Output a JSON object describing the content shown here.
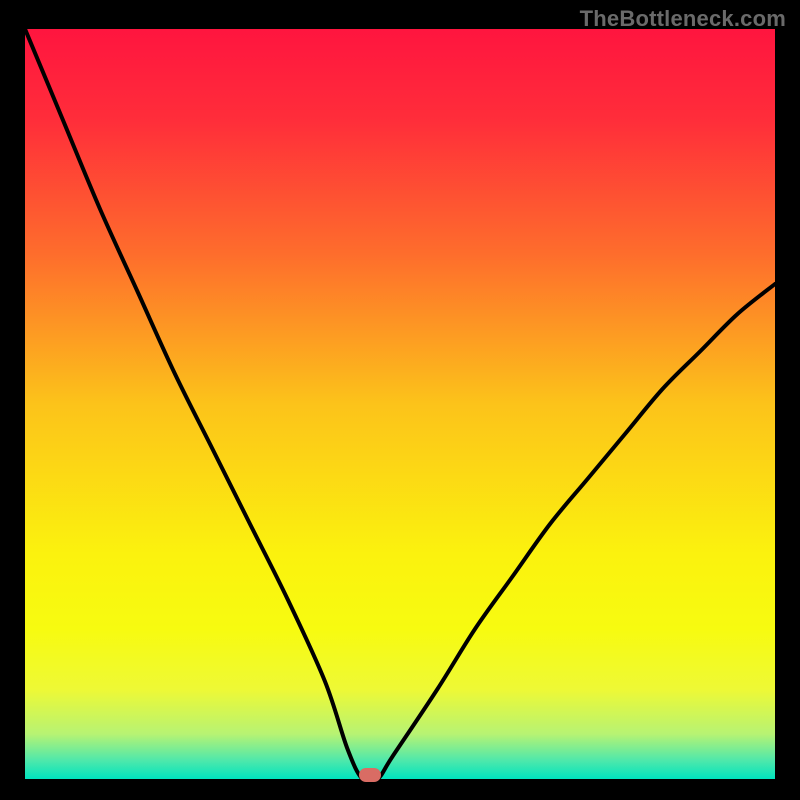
{
  "watermark": "TheBottleneck.com",
  "chart_data": {
    "type": "line",
    "title": "",
    "xlabel": "",
    "ylabel": "",
    "xlim": [
      0,
      100
    ],
    "ylim": [
      0,
      100
    ],
    "grid": false,
    "series": [
      {
        "name": "curve",
        "x": [
          0,
          5,
          10,
          15,
          20,
          25,
          30,
          35,
          40,
          43,
          45,
          47,
          49,
          55,
          60,
          65,
          70,
          75,
          80,
          85,
          90,
          95,
          100
        ],
        "y": [
          100,
          88,
          76,
          65,
          54,
          44,
          34,
          24,
          13,
          4,
          0,
          0,
          3,
          12,
          20,
          27,
          34,
          40,
          46,
          52,
          57,
          62,
          66
        ]
      }
    ],
    "marker": {
      "x": 46,
      "y": 0.5,
      "color": "#d96c64"
    },
    "gradient_stops": [
      {
        "offset": 0.0,
        "color": "#ff153f"
      },
      {
        "offset": 0.12,
        "color": "#ff2d3a"
      },
      {
        "offset": 0.3,
        "color": "#fe6d2c"
      },
      {
        "offset": 0.5,
        "color": "#fcc31a"
      },
      {
        "offset": 0.7,
        "color": "#fbf20e"
      },
      {
        "offset": 0.8,
        "color": "#f7fb10"
      },
      {
        "offset": 0.88,
        "color": "#eef935"
      },
      {
        "offset": 0.94,
        "color": "#b7f373"
      },
      {
        "offset": 0.975,
        "color": "#4fe8ab"
      },
      {
        "offset": 1.0,
        "color": "#00e4be"
      }
    ]
  }
}
